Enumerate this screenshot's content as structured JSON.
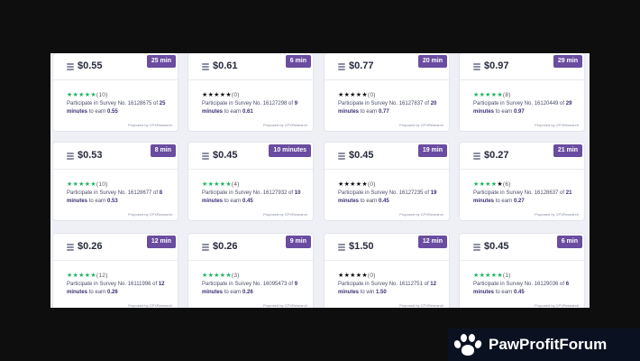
{
  "brand": {
    "name": "PawProfitForum",
    "paw_icon": "paw-icon"
  },
  "colors": {
    "badge": "#6a4ca0",
    "star_green": "#1fb564",
    "star_black": "#111111",
    "panel_bg": "#eef0f5"
  },
  "surveys": [
    {
      "price": "$0.55",
      "duration": "25 min",
      "stars": 5,
      "star_color": "green",
      "reviews": "(10)",
      "text": "Participate in Survey No. 16128675 of",
      "time_text": "25 minutes",
      "reward_text": "to earn",
      "reward": "0.55",
      "proposed_by": "Proposed by CPXResearch"
    },
    {
      "price": "$0.61",
      "duration": "6 min",
      "stars": 5,
      "star_color": "black",
      "reviews": "(0)",
      "text": "Participate in Survey No. 16127298 of",
      "time_text": "9 minutes",
      "reward_text": "to earn",
      "reward": "0.61",
      "proposed_by": "Proposed by CPXResearch"
    },
    {
      "price": "$0.77",
      "duration": "20 min",
      "stars": 5,
      "star_color": "black",
      "reviews": "(0)",
      "text": "Participate in Survey No. 16127837 of",
      "time_text": "20 minutes",
      "reward_text": "to earn",
      "reward": "0.77",
      "proposed_by": "Proposed by CPXResearch"
    },
    {
      "price": "$0.97",
      "duration": "29 min",
      "stars": 5,
      "star_color": "green",
      "reviews": "(8)",
      "text": "Participate in Survey No. 16120449 of",
      "time_text": "29 minutes",
      "reward_text": "to earn",
      "reward": "0.97",
      "proposed_by": "Proposed by CPXResearch"
    },
    {
      "price": "$0.53",
      "duration": "8 min",
      "stars": 5,
      "star_color": "green",
      "reviews": "(10)",
      "text": "Participate in Survey No. 16128677 of",
      "time_text": "8 minutes",
      "reward_text": "to earn",
      "reward": "0.53",
      "proposed_by": "Proposed by CPXResearch"
    },
    {
      "price": "$0.45",
      "duration": "10 minutes",
      "stars": 5,
      "star_color": "green",
      "reviews": "(4)",
      "text": "Participate in Survey No. 16127932 of",
      "time_text": "10 minutes",
      "reward_text": "to earn",
      "reward": "0.45",
      "proposed_by": "Proposed by CPXResearch"
    },
    {
      "price": "$0.45",
      "duration": "19 min",
      "stars": 5,
      "star_color": "black",
      "reviews": "(0)",
      "text": "Participate in Survey No. 16127235 of",
      "time_text": "19 minutes",
      "reward_text": "to earn",
      "reward": "0.45",
      "proposed_by": "Proposed by CPXResearch"
    },
    {
      "price": "$0.27",
      "duration": "21 min",
      "stars": 4,
      "star_color": "green",
      "reviews": "(6)",
      "text": "Participate in Survey No. 16128637 of",
      "time_text": "21 minutes",
      "reward_text": "to earn",
      "reward": "0.27",
      "proposed_by": "Proposed by CPXResearch"
    },
    {
      "price": "$0.26",
      "duration": "12 min",
      "stars": 5,
      "star_color": "green",
      "reviews": "(12)",
      "text": "Participate in Survey No. 16111996 of",
      "time_text": "12 minutes",
      "reward_text": "to earn",
      "reward": "0.26",
      "proposed_by": "Proposed by CPXResearch"
    },
    {
      "price": "$0.26",
      "duration": "9 min",
      "stars": 5,
      "star_color": "green",
      "reviews": "(3)",
      "text": "Participate in Survey No. 16095473 of",
      "time_text": "9 minutes",
      "reward_text": "to earn",
      "reward": "0.26",
      "proposed_by": "Proposed by CPXResearch"
    },
    {
      "price": "$1.50",
      "duration": "12 min",
      "stars": 5,
      "star_color": "black",
      "reviews": "(0)",
      "text": "Participate in Survey No. 16112751 of",
      "time_text": "12 minutes",
      "reward_text": "to win",
      "reward": "1.50",
      "proposed_by": "Proposed by CPXResearch"
    },
    {
      "price": "$0.45",
      "duration": "6 min",
      "stars": 5,
      "star_color": "green",
      "reviews": "(1)",
      "text": "Participate in Survey No. 16129036 of",
      "time_text": "6 minutes",
      "reward_text": "to earn",
      "reward": "0.45",
      "proposed_by": "Proposed by CPXResearch"
    }
  ]
}
